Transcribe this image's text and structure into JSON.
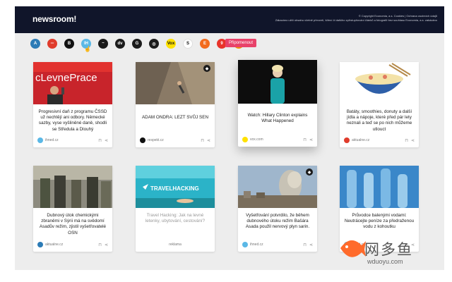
{
  "app": {
    "logo": "newsroom!"
  },
  "legal": {
    "line1": "© Copyright Economia, a.s. Cookies | Ochrana osobních údajů",
    "line2": "Zákazáno užití obsahu včetně převzetí, šíření či dalšího zpřístupňování článků a fotografií bez souhlasu Economia, a.s. zakázáno"
  },
  "sources": [
    {
      "icon": "source-a-icon",
      "glyph": "A",
      "color": "#2c7bb6"
    },
    {
      "icon": "source-aktualne-icon",
      "glyph": "═",
      "color": "#e03c2c"
    },
    {
      "icon": "source-b-icon",
      "glyph": "B",
      "color": "#111111"
    },
    {
      "icon": "source-ihned-icon",
      "glyph": "IH",
      "color": "#5bb8e6"
    },
    {
      "icon": "source-lidovky-icon",
      "glyph": "~",
      "color": "#1b1b1b"
    },
    {
      "icon": "source-dvtv-icon",
      "glyph": "dv",
      "color": "#1b1b1b"
    },
    {
      "icon": "source-g-icon",
      "glyph": "G",
      "color": "#1b1b1b"
    },
    {
      "icon": "source-globe-icon",
      "glyph": "◎",
      "color": "#1b1b1b"
    },
    {
      "icon": "source-vox-icon",
      "glyph": "Vox",
      "color": "#ffe100"
    },
    {
      "icon": "source-s-icon",
      "glyph": "S",
      "color": "#ffffff"
    },
    {
      "icon": "source-e-icon",
      "glyph": "E",
      "color": "#f26b1d"
    },
    {
      "icon": "source-red-icon",
      "glyph": "9",
      "color": "#e8332a"
    },
    {
      "icon": "source-wheel-icon",
      "glyph": "◉",
      "color": "#f39200"
    }
  ],
  "filter_pill": "Připomenout",
  "cards": [
    {
      "title": "Progresivní daň z programu ČSSD už nechtějí ani odbory. Německé sazby, vyse vyšliněné daně, shodli se Středula a Dlouhý",
      "source": "ihned.cz",
      "thumb": "thumb-speaker",
      "thumb_text": "cLevnePrace",
      "fav_color": "#5bb8e6",
      "muted": false
    },
    {
      "title": "ADAM ONDRA: LEZT SVŮJ SEN",
      "source": "respekt.cz",
      "thumb": "thumb-climber",
      "fav_color": "#111111",
      "muted": false
    },
    {
      "title": "Watch: Hillary Clinton explains What Happened",
      "source": "vox.com",
      "thumb": "thumb-clinton",
      "fav_color": "#ffe100",
      "muted": false
    },
    {
      "title": "Batáty, smoothies, donuty a další jídla a nápoje, které před pár lety neznali a teď se po nich můžeme utlouct",
      "source": "aktualne.cz",
      "thumb": "thumb-noodles",
      "fav_color": "#e03c2c",
      "muted": false
    },
    {
      "title": "Dubnový útok chemickými zbraněmi v Sýrii má na svědomí Asadův režim, zjistil vyšetřovatelé OSN",
      "source": "aktualne.cz",
      "thumb": "thumb-soldiers",
      "fav_color": "#2c7bb6",
      "muted": false
    },
    {
      "title": "Travel Hacking: Jak na levné letenky, ubytování, cestování?",
      "source": "reklama",
      "thumb": "thumb-travelhacking",
      "thumb_text": "TRAVELHACKING",
      "fav_color": "#ffffff",
      "muted": true
    },
    {
      "title": "Vyšetřování potvrdilo, že během dubnového útoku režim Bašára Asada použil nervový plyn sarin.",
      "source": "ihned.cz",
      "thumb": "thumb-smoke",
      "fav_color": "#5bb8e6",
      "muted": false
    },
    {
      "title": "Průvodce balenými vodami: Neutrácejte peníze za předraženou vodu z kohoutku",
      "source": "ihned.cz",
      "thumb": "thumb-water",
      "fav_color": "#5bb8e6",
      "muted": false
    }
  ],
  "watermark": {
    "brand": "网多鱼",
    "url": "wduoyu.com"
  }
}
